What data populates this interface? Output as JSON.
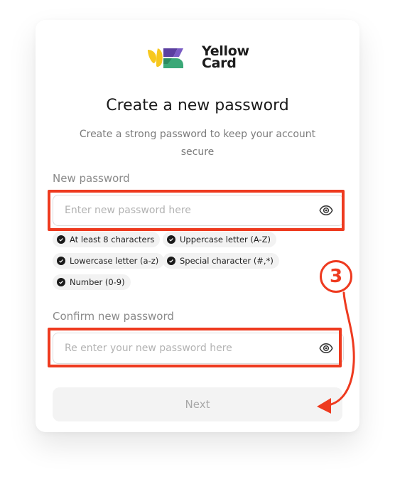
{
  "brand": {
    "name_line1": "Yellow",
    "name_line2": "Card"
  },
  "title": "Create a new password",
  "subtitle": "Create a strong password to keep your account secure",
  "new_password": {
    "label": "New password",
    "placeholder": "Enter new password here",
    "value": ""
  },
  "requirements": [
    {
      "label": "At least 8 characters"
    },
    {
      "label": "Uppercase letter (A-Z)"
    },
    {
      "label": "Lowercase letter (a-z)"
    },
    {
      "label": "Special character (#,*)"
    },
    {
      "label": "Number (0-9)"
    }
  ],
  "confirm_password": {
    "label": "Confirm new password",
    "placeholder": "Re enter your new password here",
    "value": ""
  },
  "next_button": {
    "label": "Next",
    "disabled": true
  },
  "annotation": {
    "step_number": "3",
    "color": "#ee3a1f"
  },
  "colors": {
    "brand_yellow": "#f7c81e",
    "brand_purple": "#5b3fa0",
    "brand_green": "#3aa877",
    "text_dark": "#1a1a1a",
    "muted": "#7b7b7b"
  }
}
